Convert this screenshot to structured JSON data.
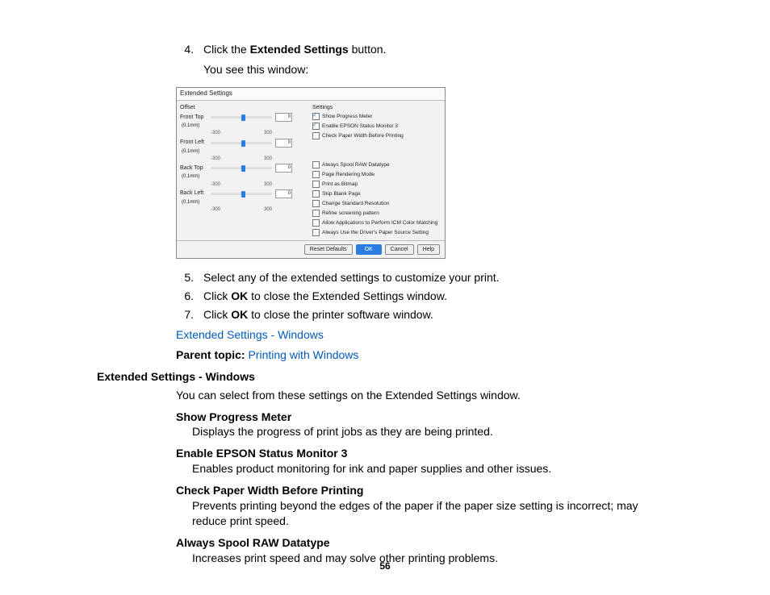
{
  "steps_a": [
    {
      "num": "4.",
      "body_pre": "Click the ",
      "bold": "Extended Settings",
      "body_post": " button.",
      "sub": "You see this window:"
    }
  ],
  "steps_b": [
    {
      "num": "5.",
      "text": "Select any of the extended settings to customize your print."
    },
    {
      "num": "6.",
      "pre": "Click ",
      "bold": "OK",
      "post": " to close the Extended Settings window."
    },
    {
      "num": "7.",
      "pre": "Click ",
      "bold": "OK",
      "post": " to close the printer software window."
    }
  ],
  "link1": "Extended Settings - Windows",
  "parent_label": "Parent topic: ",
  "parent_link": "Printing with Windows",
  "section_heading": "Extended Settings - Windows",
  "section_intro": "You can select from these settings on the Extended Settings window.",
  "defs": [
    {
      "term": "Show Progress Meter",
      "desc": "Displays the progress of print jobs as they are being printed."
    },
    {
      "term": "Enable EPSON Status Monitor 3",
      "desc": "Enables product monitoring for ink and paper supplies and other issues."
    },
    {
      "term": "Check Paper Width Before Printing",
      "desc": "Prevents printing beyond the edges of the paper if the paper size setting is incorrect; may reduce print speed."
    },
    {
      "term": "Always Spool RAW Datatype",
      "desc": "Increases print speed and may solve other printing problems."
    }
  ],
  "page_number": "56",
  "dialog": {
    "title": "Extended Settings",
    "offset_label": "Offset",
    "settings_label": "Settings",
    "sliders": [
      {
        "name": "Front Top",
        "min": "-300",
        "max": "300",
        "val": "0",
        "unit": "(0.1mm)"
      },
      {
        "name": "Front Left",
        "min": "-300",
        "max": "300",
        "val": "0",
        "unit": "(0.1mm)"
      },
      {
        "name": "Back Top",
        "min": "-300",
        "max": "300",
        "val": "0",
        "unit": "(0.1mm)"
      },
      {
        "name": "Back Left",
        "min": "-300",
        "max": "300",
        "val": "0",
        "unit": "(0.1mm)"
      }
    ],
    "checks_top": [
      {
        "on": true,
        "label": "Show Progress Meter"
      },
      {
        "on": true,
        "label": "Enable EPSON Status Monitor 3"
      },
      {
        "on": false,
        "label": "Check Paper Width Before Printing"
      }
    ],
    "checks_bottom": [
      {
        "on": false,
        "label": "Always Spool RAW Datatype"
      },
      {
        "on": false,
        "label": "Page Rendering Mode"
      },
      {
        "on": false,
        "label": "Print as Bitmap"
      },
      {
        "on": false,
        "label": "Skip Blank Page"
      },
      {
        "on": false,
        "label": "Change Standard Resolution"
      },
      {
        "on": false,
        "label": "Refine screening pattern"
      },
      {
        "on": false,
        "label": "Allow Applications to Perform ICM Color Matching"
      },
      {
        "on": false,
        "label": "Always Use the Driver's Paper Source Setting"
      }
    ],
    "buttons": {
      "reset": "Reset Defaults",
      "ok": "OK",
      "cancel": "Cancel",
      "help": "Help"
    }
  }
}
